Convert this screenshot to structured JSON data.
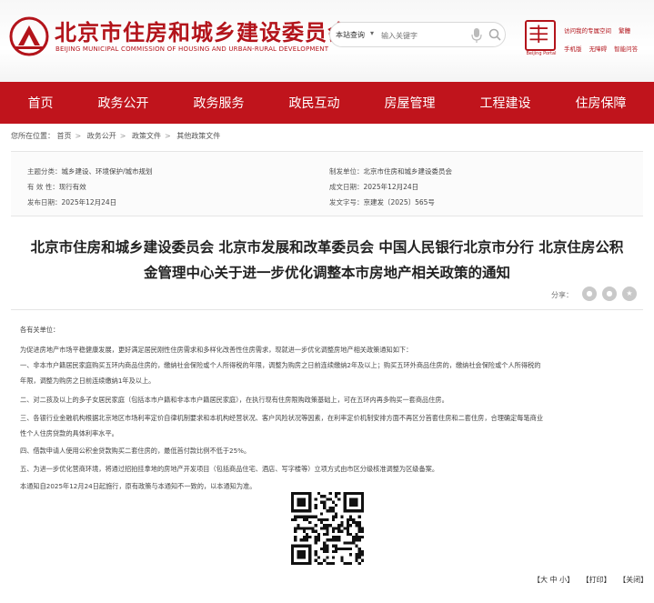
{
  "header": {
    "title": "北京市住房和城乡建设委员会",
    "subtitle": "BEIJING MUNICIPAL COMMISSION OF HOUSING AND URBAN-RURAL DEVELOPMENT",
    "search_scope": "本站查询",
    "search_placeholder": "输入关键字",
    "links_row1": [
      "访问我的专属空间",
      "繁體"
    ],
    "links_row2": [
      "手机版",
      "无障碍",
      "智能问答"
    ]
  },
  "nav": [
    "首页",
    "政务公开",
    "政务服务",
    "政民互动",
    "房屋管理",
    "工程建设",
    "住房保障"
  ],
  "breadcrumb": {
    "prefix": "您所在位置：",
    "items": [
      "首页",
      "政务公开",
      "政策文件",
      "其他政策文件"
    ]
  },
  "meta": {
    "topic_k": "主题分类：",
    "topic_v": "城乡建设、环境保护/城市规划",
    "valid_k": "有 效 性：",
    "valid_v": "现行有效",
    "pub_k": "发布日期：",
    "pub_v": "2025年12月24日",
    "org_k": "制发单位：",
    "org_v": "北京市住房和城乡建设委员会",
    "made_k": "成文日期：",
    "made_v": "2025年12月24日",
    "num_k": "发文字号：",
    "num_v": "京建发〔2025〕565号"
  },
  "doc": {
    "title_line1": "北京市住房和城乡建设委员会 北京市发展和改革委员会 中国人民银行北京市分行 北京住房公积",
    "title_line2": "金管理中心关于进一步优化调整本市房地产相关政策的通知",
    "share_label": "分享：",
    "lines": [
      "各有关单位：",
      "    为促进房地产市场平稳健康发展，更好满足居民刚性住房需求和多样化改善性住房需求，现就进一步优化调整房地产相关政策通知如下：",
      "    一、非本市户籍居民家庭购买五环内商品住房的，缴纳社会保险或个人所得税的年限，调整为购房之日前连续缴纳2年及以上；购买五环外商品住房的，缴纳社会保险或个人所得税的",
      "年限，调整为购房之日前连续缴纳1年及以上。",
      "    二、对二孩及以上的多子女居民家庭（包括本市户籍和非本市户籍居民家庭），在执行现有住房限购政策基础上，可在五环内再多购买一套商品住房。",
      "    三、各银行业金融机构根据北京地区市场利率定价自律机制要求和本机构经营状况、客户风险状况等因素，在利率定价机制安排方面不再区分首套住房和二套住房，合理确定每笔商业",
      "性个人住房贷款的具体利率水平。",
      "    四、借款申请人使用公积金贷款购买二套住房的，最低首付款比例不低于25%。",
      "    五、为进一步优化营商环境，将通过招拍挂拿地的房地产开发项目（包括商品住宅、酒店、写字楼等）立项方式由市区分级核准调整为区级备案。",
      "    本通知自2025年12月24日起施行，原有政策与本通知不一致的，以本通知为准。"
    ]
  },
  "footer": {
    "font_size": "【大 中 小】",
    "print": "【打印】",
    "close": "【关闭】"
  },
  "colors": {
    "brand_red": "#c0141c",
    "title_red": "#b3141b"
  }
}
